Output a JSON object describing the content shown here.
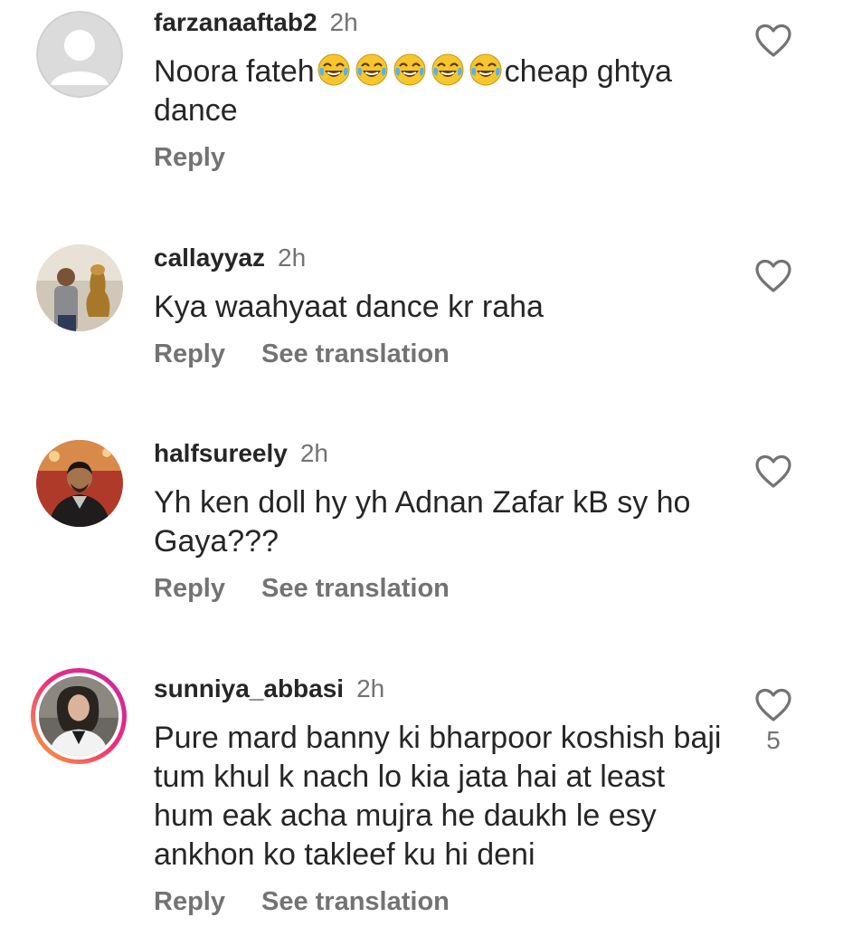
{
  "comments": [
    {
      "username": "farzanaaftab2",
      "time": "2h",
      "text_before": "Noora fateh",
      "emoji": "😂😂😂😂😂",
      "text_after": "cheap ghtya dance",
      "reply": "Reply",
      "avatar": "default-avatar-icon"
    },
    {
      "username": "callayyaz",
      "time": "2h",
      "text": "Kya waahyaat dance kr raha",
      "reply": "Reply",
      "translate": "See translation",
      "avatar": "profile-photo"
    },
    {
      "username": "halfsureely",
      "time": "2h",
      "text": "Yh ken doll hy yh Adnan Zafar kB sy ho Gaya???",
      "reply": "Reply",
      "translate": "See translation",
      "avatar": "profile-photo"
    },
    {
      "username": "sunniya_abbasi",
      "time": "2h",
      "text": "Pure mard banny ki bharpoor koshish baji tum khul k nach lo kia jata hai at least hum eak acha mujra he daukh le esy ankhon ko takleef ku hi deni",
      "reply": "Reply",
      "translate": "See translation",
      "like_count": "5",
      "avatar": "profile-photo-story-ring"
    }
  ],
  "colors": {
    "text": "#262626",
    "secondary": "#737373",
    "story_ring_start": "#f9a53a",
    "story_ring_end": "#c32aa3"
  }
}
